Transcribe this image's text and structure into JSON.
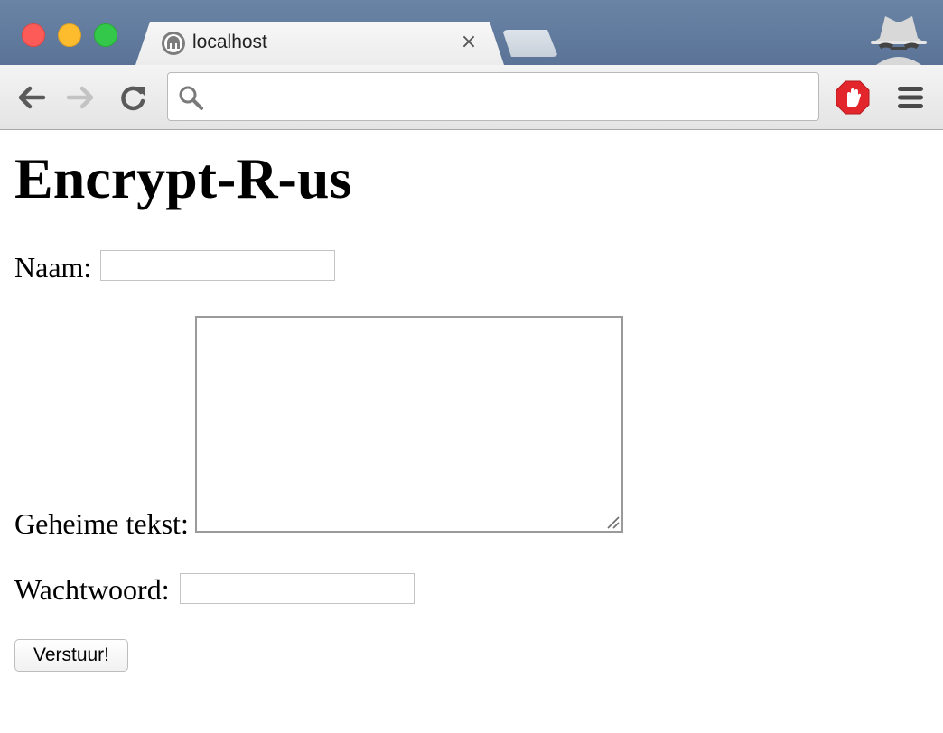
{
  "browser": {
    "tab_title": "localhost",
    "tab_close_glyph": "×",
    "address_value": "",
    "icons": [
      "back-icon",
      "forward-icon",
      "reload-icon",
      "search-icon",
      "adblock-icon",
      "menu-icon",
      "incognito-icon",
      "tab-favicon"
    ]
  },
  "page": {
    "title": "Encrypt-R-us",
    "form": {
      "name_label": "Naam:",
      "name_value": "",
      "secret_label": "Geheime tekst:",
      "secret_value": "",
      "password_label": "Wachtwoord:",
      "password_value": "",
      "submit_label": "Verstuur!"
    }
  },
  "colors": {
    "titlebar": "#5f7a9e",
    "close": "#fc5b57",
    "minimize": "#fdbc2e",
    "maximize": "#34c84a",
    "adblock": "#e2262b"
  }
}
